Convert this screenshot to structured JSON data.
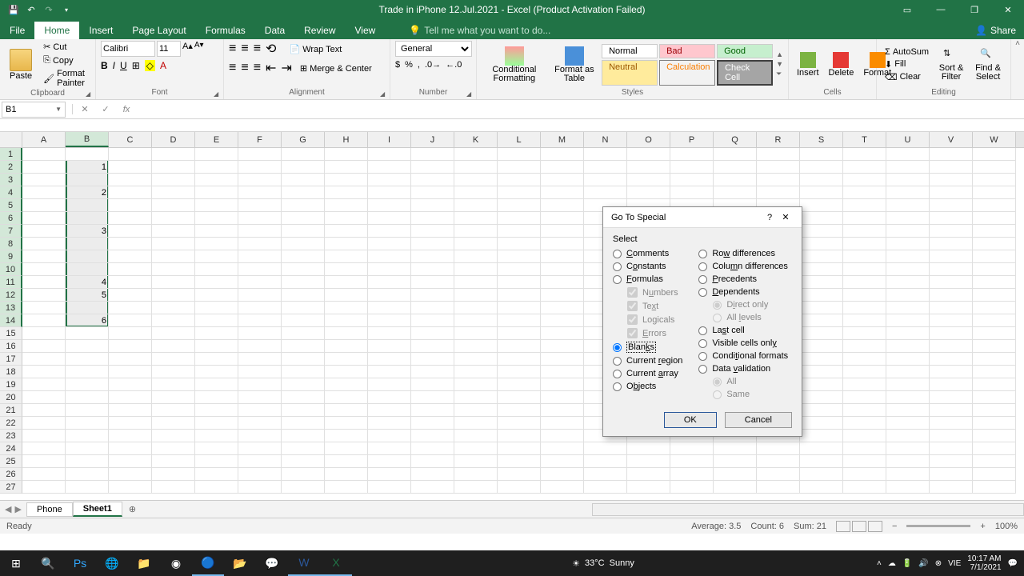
{
  "titlebar": {
    "title": "Trade in iPhone 12.Jul.2021 - Excel (Product Activation Failed)"
  },
  "tabs": {
    "file": "File",
    "home": "Home",
    "insert": "Insert",
    "page_layout": "Page Layout",
    "formulas": "Formulas",
    "data": "Data",
    "review": "Review",
    "view": "View",
    "tell_me": "Tell me what you want to do...",
    "share": "Share"
  },
  "ribbon": {
    "clipboard": {
      "label": "Clipboard",
      "paste": "Paste",
      "cut": "Cut",
      "copy": "Copy",
      "format_painter": "Format Painter"
    },
    "font": {
      "label": "Font",
      "name": "Calibri",
      "size": "11"
    },
    "alignment": {
      "label": "Alignment",
      "wrap": "Wrap Text",
      "merge": "Merge & Center"
    },
    "number": {
      "label": "Number",
      "format": "General"
    },
    "styles": {
      "label": "Styles",
      "conditional": "Conditional Formatting",
      "format_table": "Format as Table",
      "normal": "Normal",
      "bad": "Bad",
      "good": "Good",
      "neutral": "Neutral",
      "calculation": "Calculation",
      "check": "Check Cell"
    },
    "cells": {
      "label": "Cells",
      "insert": "Insert",
      "delete": "Delete",
      "format": "Format"
    },
    "editing": {
      "label": "Editing",
      "autosum": "AutoSum",
      "fill": "Fill",
      "clear": "Clear",
      "sort": "Sort & Filter",
      "find": "Find & Select"
    }
  },
  "name_box": "B1",
  "cells_data": {
    "B2": "1",
    "B4": "2",
    "B7": "3",
    "B11": "4",
    "B12": "5",
    "B14": "6"
  },
  "columns": [
    "A",
    "B",
    "C",
    "D",
    "E",
    "F",
    "G",
    "H",
    "I",
    "J",
    "K",
    "L",
    "M",
    "N",
    "O",
    "P",
    "Q",
    "R",
    "S",
    "T",
    "U",
    "V",
    "W"
  ],
  "dialog": {
    "title": "Go To Special",
    "select": "Select",
    "comments": "Comments",
    "constants": "Constants",
    "formulas": "Formulas",
    "numbers": "Numbers",
    "text": "Text",
    "logicals": "Logicals",
    "errors": "Errors",
    "blanks": "Blanks",
    "current_region": "Current region",
    "current_array": "Current array",
    "objects": "Objects",
    "row_diff": "Row differences",
    "col_diff": "Column differences",
    "precedents": "Precedents",
    "dependents": "Dependents",
    "direct_only": "Direct only",
    "all_levels": "All levels",
    "last_cell": "Last cell",
    "visible": "Visible cells only",
    "cond_formats": "Conditional formats",
    "data_val": "Data validation",
    "all": "All",
    "same": "Same",
    "ok": "OK",
    "cancel": "Cancel"
  },
  "sheets": {
    "phone": "Phone",
    "sheet1": "Sheet1"
  },
  "status": {
    "ready": "Ready",
    "average": "Average: 3.5",
    "count": "Count: 6",
    "sum": "Sum: 21",
    "zoom": "100%"
  },
  "taskbar": {
    "weather_temp": "33°C",
    "weather_desc": "Sunny",
    "lang": "VIE",
    "time": "10:17 AM",
    "date": "7/1/2021"
  }
}
